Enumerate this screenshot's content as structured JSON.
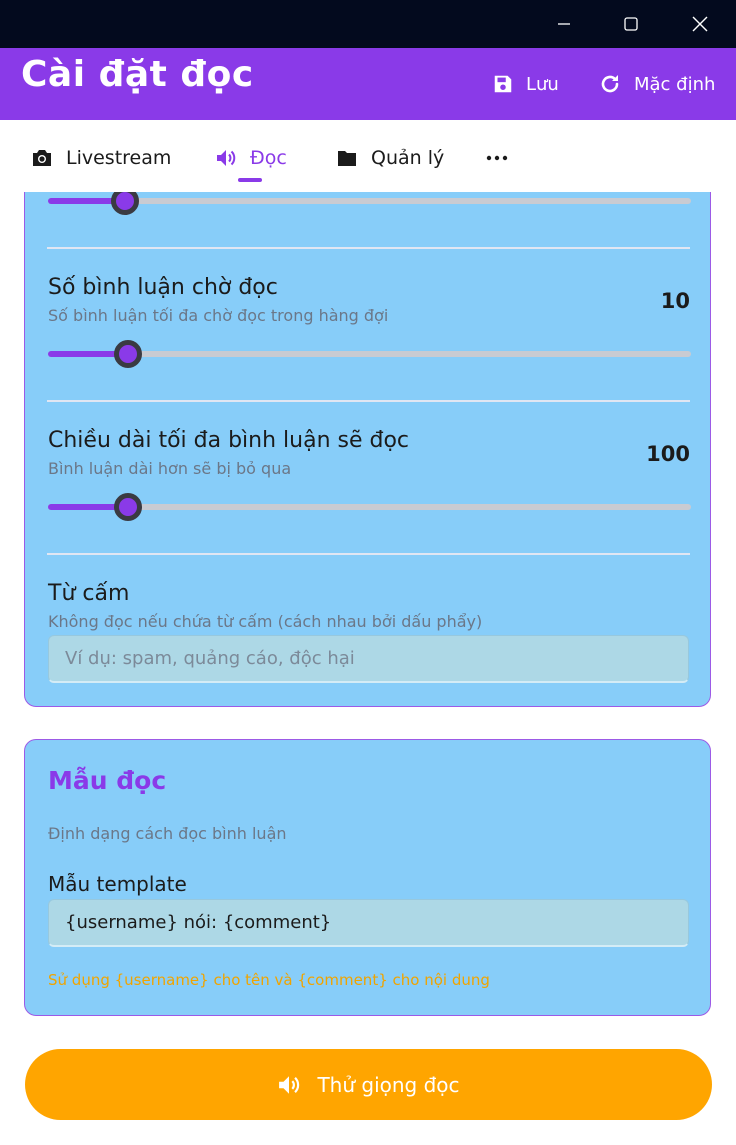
{
  "appbar": {
    "title": "Cài đặt đọc",
    "save_label": "Lưu",
    "default_label": "Mặc định"
  },
  "tabs": [
    {
      "label": "Livestream",
      "icon": "camera-icon",
      "active": false
    },
    {
      "label": "Đọc",
      "icon": "speaker-icon",
      "active": true
    },
    {
      "label": "Quản lý",
      "icon": "folder-icon",
      "active": false
    },
    {
      "label": "more-icon",
      "icon": "more-icon",
      "active": false
    }
  ],
  "reading_settings": {
    "top_slider": {
      "fraction": 0.12
    },
    "queue": {
      "title": "Số bình luận chờ đọc",
      "subtitle": "Số bình luận tối đa chờ đọc trong hàng đợi",
      "value": "10",
      "fraction": 0.125
    },
    "max_length": {
      "title": "Chiều dài tối đa bình luận sẽ đọc",
      "subtitle": "Bình luận dài hơn sẽ bị bỏ qua",
      "value": "100",
      "fraction": 0.125
    },
    "banned_words": {
      "title": "Từ cấm",
      "subtitle": "Không đọc nếu chứa từ cấm (cách nhau bởi dấu phẩy)",
      "placeholder": "Ví dụ: spam, quảng cáo, độc hại",
      "value": ""
    }
  },
  "template_card": {
    "heading": "Mẫu đọc",
    "description": "Định dạng cách đọc bình luận",
    "field_label": "Mẫu template",
    "field_value": "{username} nói: {comment}",
    "hint": "Sử dụng {username} cho tên và {comment} cho nội dung"
  },
  "try_button": {
    "label": "Thử giọng đọc"
  },
  "colors": {
    "accent": "#8a3ae8",
    "card_bg": "#87cdf9",
    "button_bg": "#ffa500",
    "titlebar": "#030a1e"
  }
}
